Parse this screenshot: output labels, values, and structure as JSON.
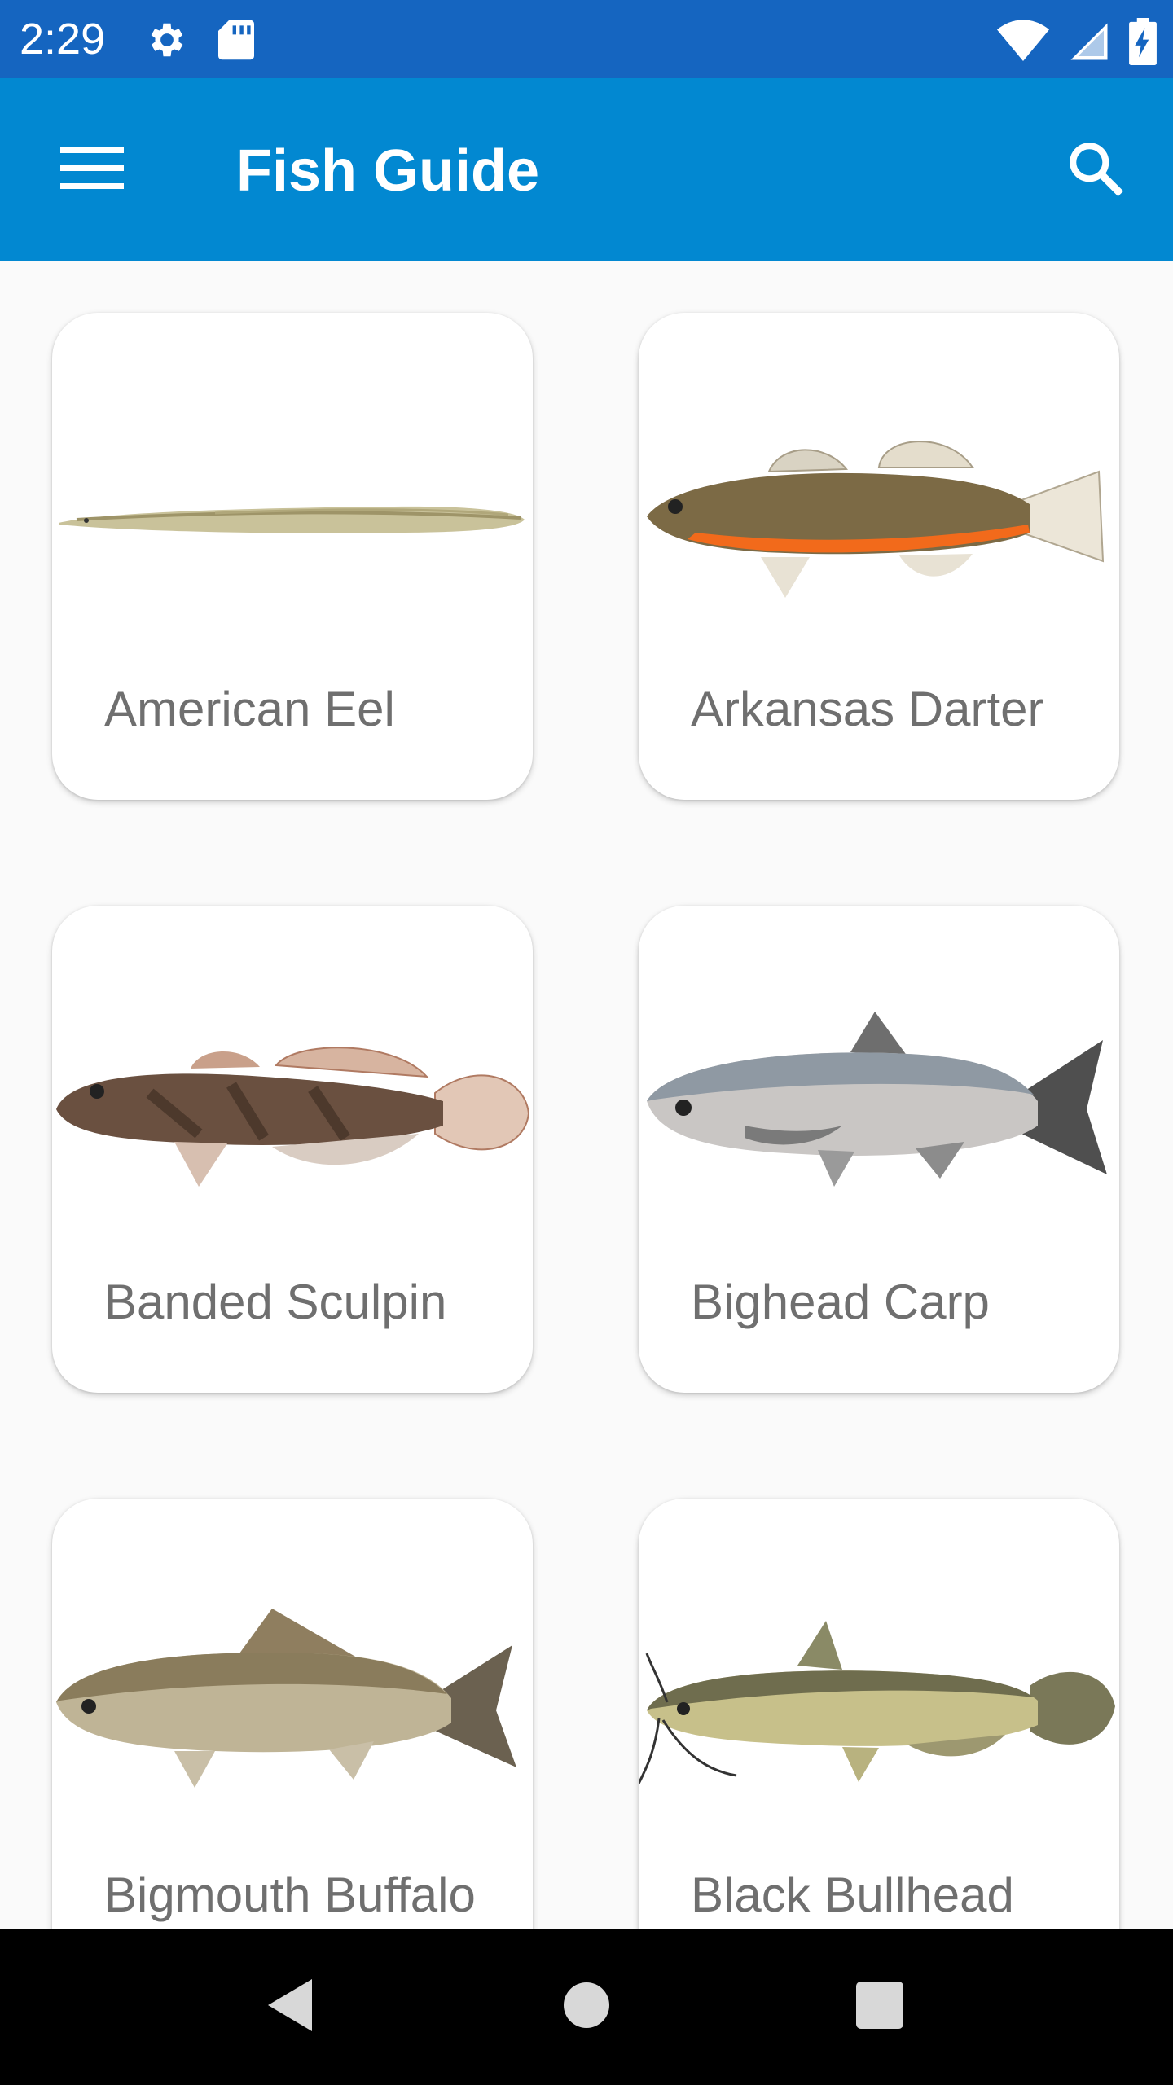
{
  "status_bar": {
    "time": "2:29",
    "icons": [
      "gear-icon",
      "sd-card-icon",
      "wifi-icon",
      "cell-signal-icon",
      "battery-charging-icon"
    ]
  },
  "app_bar": {
    "title": "Fish Guide",
    "menu_icon": "hamburger-menu-icon",
    "search_icon": "search-icon",
    "color": "#0288d1",
    "status_color": "#1565c0"
  },
  "fish": [
    {
      "name": "American Eel"
    },
    {
      "name": "Arkansas Darter"
    },
    {
      "name": "Banded Sculpin"
    },
    {
      "name": "Bighead Carp"
    },
    {
      "name": "Bigmouth Buffalo"
    },
    {
      "name": "Black Bullhead"
    }
  ],
  "nav_bar": {
    "icons": [
      "back-icon",
      "home-icon",
      "recents-icon"
    ]
  }
}
